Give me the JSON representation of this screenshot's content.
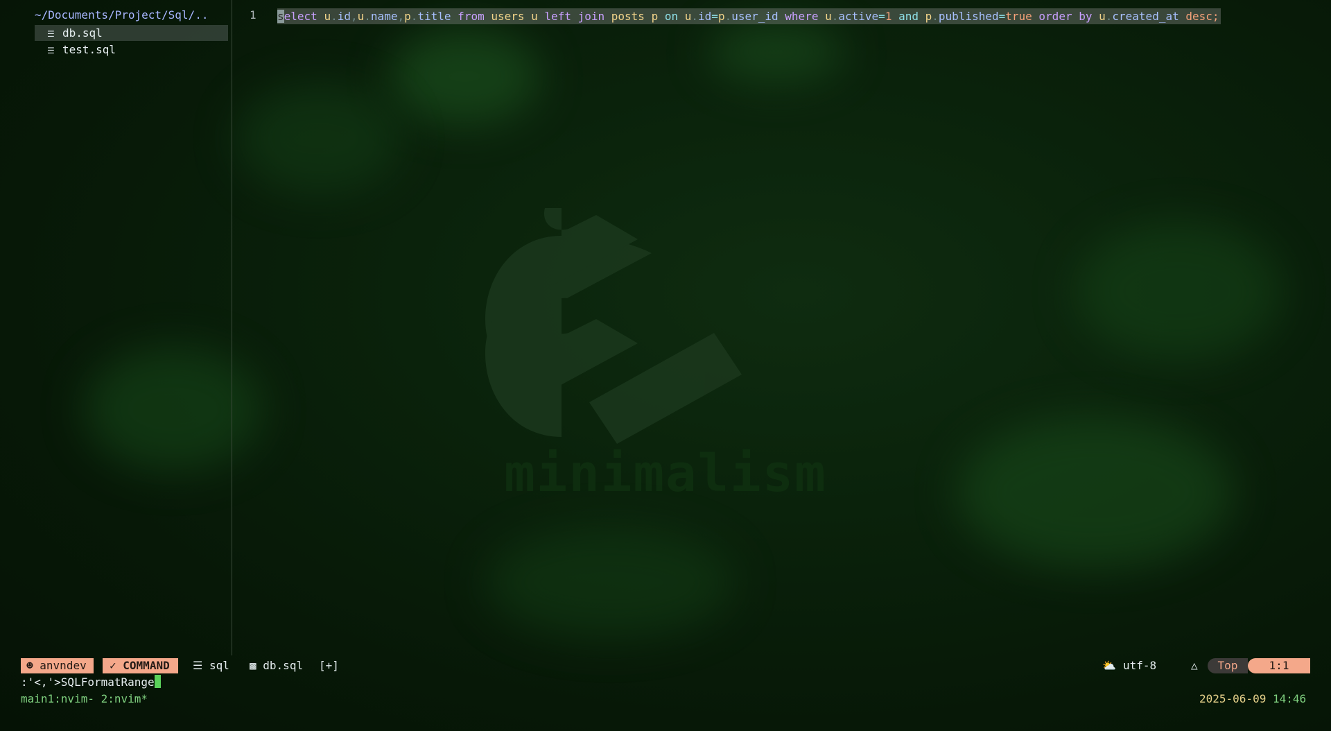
{
  "explorer": {
    "path": "~/Documents/Project/Sql/..",
    "files": [
      {
        "name": "db.sql",
        "icon": "database-icon",
        "selected": true
      },
      {
        "name": "test.sql",
        "icon": "database-icon",
        "selected": false
      }
    ]
  },
  "editor": {
    "line_number": "1",
    "code_tokens": {
      "t1": "select",
      "t2": " ",
      "t3": "u",
      "t4": ".",
      "t5": "id",
      "t6": ",",
      "t7": "u",
      "t8": ".",
      "t9": "name",
      "t10": ",",
      "t11": "p",
      "t12": ".",
      "t13": "title",
      "t14": " from ",
      "t15": "users",
      "t16": " u ",
      "t17": "left join",
      "t18": " ",
      "t19": "posts",
      "t20": " p ",
      "t21": "on",
      "t22": " ",
      "t23": "u",
      "t24": ".",
      "t25": "id",
      "t26": "=",
      "t27": "p",
      "t28": ".",
      "t29": "user_id",
      "t30": " where ",
      "t31": "u",
      "t32": ".",
      "t33": "active",
      "t34": "=",
      "t35": "1",
      "t36": " and ",
      "t37": "p",
      "t38": ".",
      "t39": "published",
      "t40": "=",
      "t41": "true",
      "t42": " order by ",
      "t43": "u",
      "t44": ".",
      "t45": "created_at",
      "t46": " desc",
      "t47": ";"
    }
  },
  "watermark": {
    "brand": "minimalism"
  },
  "statusline": {
    "user": "anvndev",
    "mode": "COMMAND",
    "filetype": "sql",
    "filename": "db.sql",
    "modified": "[+]",
    "encoding": "utf-8",
    "position_label": "Top",
    "cursor": "1:1",
    "weather_icon": "weather-icon",
    "os_icon": "linux-icon"
  },
  "command_line": {
    "text": ":'<,'>SQLFormatRange"
  },
  "tmux": {
    "left": "main1:nvim- 2:nvim*",
    "date": "2025-06-09",
    "time": "14:46"
  },
  "colors": {
    "accent": "#f4a88a",
    "background": "#0a220b"
  }
}
